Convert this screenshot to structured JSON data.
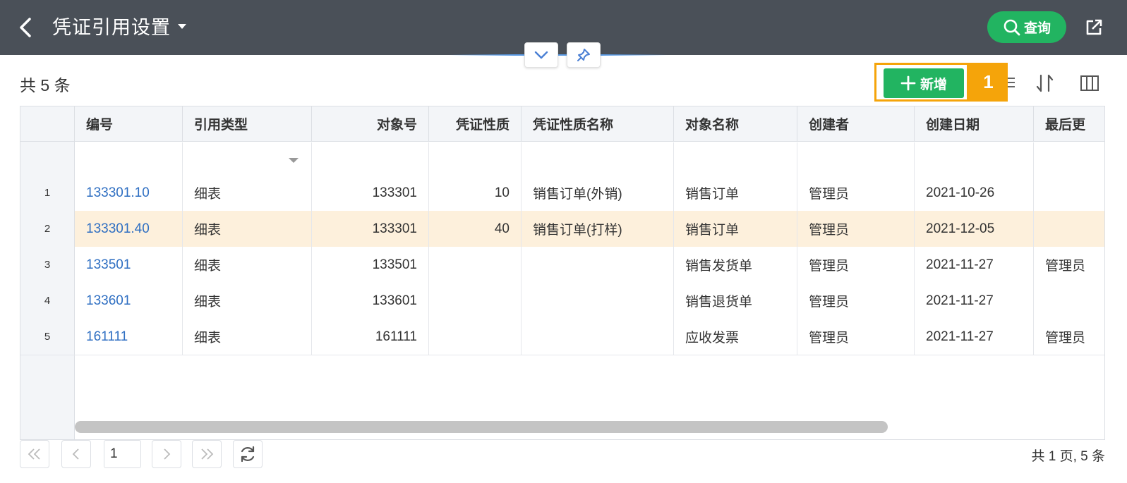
{
  "header": {
    "title": "凭证引用设置",
    "query_label": "查询"
  },
  "toolbar": {
    "count_text": "共 5 条",
    "add_label": "新增",
    "step_badge": "1"
  },
  "table": {
    "columns": [
      "编号",
      "引用类型",
      "对象号",
      "凭证性质",
      "凭证性质名称",
      "对象名称",
      "创建者",
      "创建日期",
      "最后更"
    ],
    "rows": [
      {
        "num": "1",
        "code": "133301.10",
        "type": "细表",
        "obj_no": "133301",
        "nature": "10",
        "nature_name": "销售订单(外销)",
        "obj_name": "销售订单",
        "creator": "管理员",
        "created": "2021-10-26",
        "last": ""
      },
      {
        "num": "2",
        "code": "133301.40",
        "type": "细表",
        "obj_no": "133301",
        "nature": "40",
        "nature_name": "销售订单(打样)",
        "obj_name": "销售订单",
        "creator": "管理员",
        "created": "2021-12-05",
        "last": ""
      },
      {
        "num": "3",
        "code": "133501",
        "type": "细表",
        "obj_no": "133501",
        "nature": "",
        "nature_name": "",
        "obj_name": "销售发货单",
        "creator": "管理员",
        "created": "2021-11-27",
        "last": "管理员"
      },
      {
        "num": "4",
        "code": "133601",
        "type": "细表",
        "obj_no": "133601",
        "nature": "",
        "nature_name": "",
        "obj_name": "销售退货单",
        "creator": "管理员",
        "created": "2021-11-27",
        "last": ""
      },
      {
        "num": "5",
        "code": "161111",
        "type": "细表",
        "obj_no": "161111",
        "nature": "",
        "nature_name": "",
        "obj_name": "应收发票",
        "creator": "管理员",
        "created": "2021-11-27",
        "last": "管理员"
      }
    ],
    "selected_row": 2
  },
  "pager": {
    "current_page": "1",
    "info": "共 1 页, 5 条"
  },
  "colors": {
    "header_bg": "#4a5058",
    "accent_green": "#22b461",
    "highlight_orange": "#f5a40a",
    "link_blue": "#2f6fc2",
    "selected_row_bg": "#fdf0dc"
  },
  "icons": [
    "back-icon",
    "caret-down-icon",
    "search-icon",
    "export-icon",
    "chevron-down-icon",
    "pin-icon",
    "plus-icon",
    "sort-icon",
    "columns-icon",
    "first-page-icon",
    "prev-page-icon",
    "next-page-icon",
    "last-page-icon",
    "refresh-icon"
  ]
}
